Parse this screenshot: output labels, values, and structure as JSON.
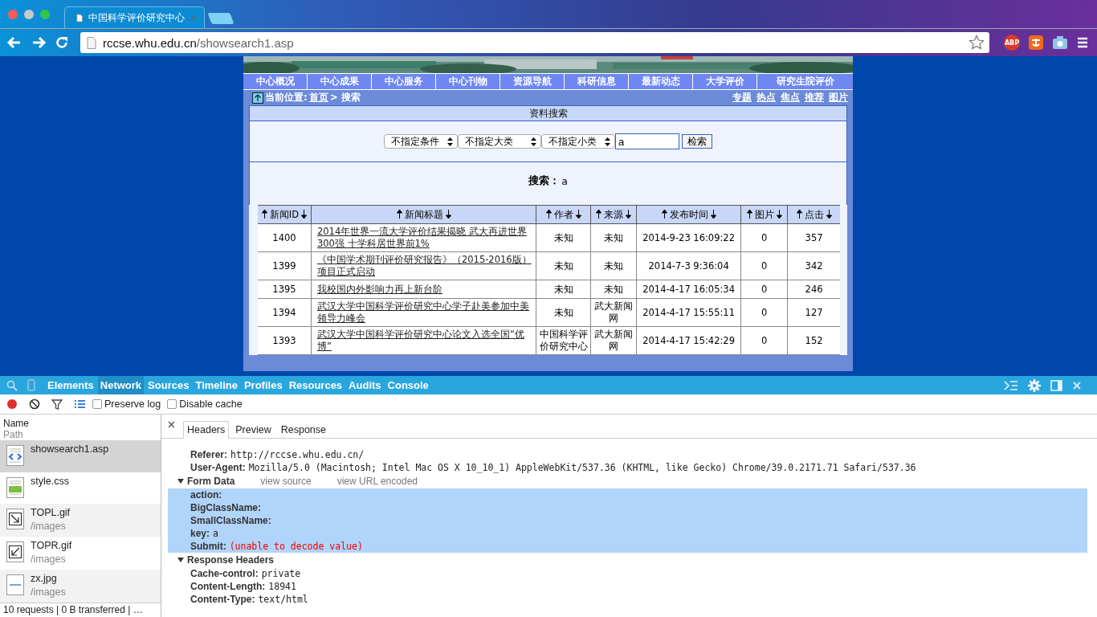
{
  "browser": {
    "tabs": [
      {
        "title": "中国科学评价研究中心",
        "selected": true
      }
    ],
    "address": {
      "host": "rccse.whu.edu.cn",
      "path": "/showsearch1.asp"
    },
    "extension_badge": "ABP"
  },
  "site": {
    "nav": [
      "中心概况",
      "中心成果",
      "中心服务",
      "中心刊物",
      "资源导航",
      "科研信息",
      "最新动态",
      "大学评价",
      "研究生院评价"
    ],
    "breadcrumb": {
      "label": "当前位置:",
      "home": "首页",
      "current": "> 搜索"
    },
    "quick_links": [
      "专题",
      "热点",
      "焦点",
      "推荐",
      "图片"
    ],
    "search_panel": {
      "title": "资料搜索",
      "selects": [
        "不指定条件",
        "不指定大类",
        "不指定小类"
      ],
      "query": "a",
      "button": "检索",
      "result_label": "搜索：",
      "result_query": "a"
    },
    "table": {
      "columns": [
        "新闻ID",
        "新闻标题",
        "作者",
        "来源",
        "发布时间",
        "图片",
        "点击"
      ],
      "rows": [
        {
          "id": "1400",
          "title": "2014年世界一流大学评价结果揭晓 武大再进世界300强 十学科居世界前1%",
          "author": "未知",
          "source": "未知",
          "time": "2014-9-23 16:09:22",
          "pictures": "0",
          "clicks": "357"
        },
        {
          "id": "1399",
          "title": "《中国学术期刊评价研究报告》（2015-2016版）项目正式启动",
          "author": "未知",
          "source": "未知",
          "time": "2014-7-3 9:36:04",
          "pictures": "0",
          "clicks": "342"
        },
        {
          "id": "1395",
          "title": "我校国内外影响力再上新台阶",
          "author": "未知",
          "source": "未知",
          "time": "2014-4-17 16:05:34",
          "pictures": "0",
          "clicks": "246"
        },
        {
          "id": "1394",
          "title": "武汉大学中国科学评价研究中心学子赴美参加中美领导力峰会",
          "author": "未知",
          "source": "武大新闻网",
          "time": "2014-4-17 15:55:11",
          "pictures": "0",
          "clicks": "127"
        },
        {
          "id": "1393",
          "title": "武汉大学中国科学评价研究中心论文入选全国“优博”",
          "author": "中国科学评价研究中心",
          "source": "武大新闻网",
          "time": "2014-4-17 15:42:29",
          "pictures": "0",
          "clicks": "152"
        }
      ]
    }
  },
  "devtools": {
    "tabs": [
      {
        "label": "Elements",
        "selected": false
      },
      {
        "label": "Network",
        "selected": true
      },
      {
        "label": "Sources",
        "selected": false
      },
      {
        "label": "Timeline",
        "selected": false
      },
      {
        "label": "Profiles",
        "selected": false
      },
      {
        "label": "Resources",
        "selected": false
      },
      {
        "label": "Audits",
        "selected": false
      },
      {
        "label": "Console",
        "selected": false
      }
    ],
    "recording": true,
    "options": [
      {
        "label": "Preserve log",
        "checked": false
      },
      {
        "label": "Disable cache",
        "checked": false
      }
    ],
    "list_header": {
      "name": "Name",
      "path": "Path"
    },
    "requests": [
      {
        "name": "showsearch1.asp",
        "kind": "html",
        "selected": true
      },
      {
        "name": "style.css",
        "kind": "css",
        "selected": false
      },
      {
        "name": "TOPL.gif",
        "path": "/images",
        "kind": "gif-left",
        "selected": false
      },
      {
        "name": "TOPR.gif",
        "path": "/images",
        "kind": "gif-right",
        "selected": false
      },
      {
        "name": "zx.jpg",
        "path": "/images",
        "kind": "jpg",
        "selected": false
      }
    ],
    "status": "10 requests | 0 B transferred | …",
    "detail_tabs": [
      {
        "label": "Headers",
        "selected": true
      },
      {
        "label": "Preview",
        "selected": false
      },
      {
        "label": "Response",
        "selected": false
      }
    ],
    "request_headers": [
      {
        "key": "Referer:",
        "value": "http://rccse.whu.edu.cn/"
      },
      {
        "key": "User-Agent:",
        "value": "Mozilla/5.0 (Macintosh; Intel Mac OS X 10_10_1) AppleWebKit/537.36 (KHTML, like Gecko) Chrome/39.0.2171.71 Safari/537.36"
      }
    ],
    "form_data": {
      "title": "Form Data",
      "expanded": true,
      "links": [
        "view source",
        "view URL encoded"
      ],
      "params": [
        {
          "key": "action:",
          "selected": true
        },
        {
          "key": "BigClassName:",
          "selected": true
        },
        {
          "key": "SmallClassName:",
          "selected": true
        },
        {
          "key": "key:",
          "value": "a",
          "selected": true,
          "error": false
        },
        {
          "key": "Submit:",
          "value": "(unable to decode value)",
          "selected": true,
          "error": true
        }
      ]
    },
    "response_headers": {
      "title": "Response Headers",
      "expanded": true,
      "items": [
        {
          "key": "Cache-control:",
          "value": "private"
        },
        {
          "key": "Content-Length:",
          "value": "18941"
        },
        {
          "key": "Content-Type:",
          "value": "text/html"
        }
      ]
    }
  }
}
